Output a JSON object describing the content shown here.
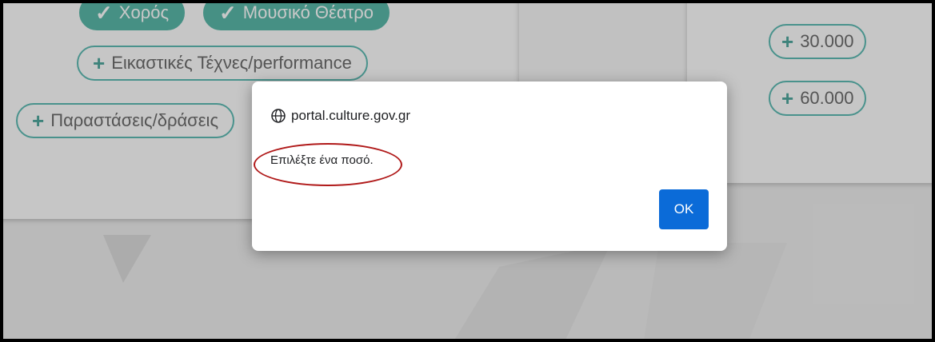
{
  "background_chips": {
    "top_left": "Χορός",
    "top_right": "Μουσικό Θέατρο",
    "visual_arts": "Εικαστικές Τέχνες/performance",
    "performances": "Παραστάσεις/δράσεις"
  },
  "amount_chips": [
    "30.000",
    "60.000"
  ],
  "plus_symbol": "+",
  "dialog": {
    "origin": "portal.culture.gov.gr",
    "message": "Επιλέξτε ένα ποσό.",
    "ok_label": "OK"
  },
  "colors": {
    "accent_teal": "#36a08f",
    "ok_button": "#0b6bd8",
    "annotation_circle": "#b01919"
  }
}
